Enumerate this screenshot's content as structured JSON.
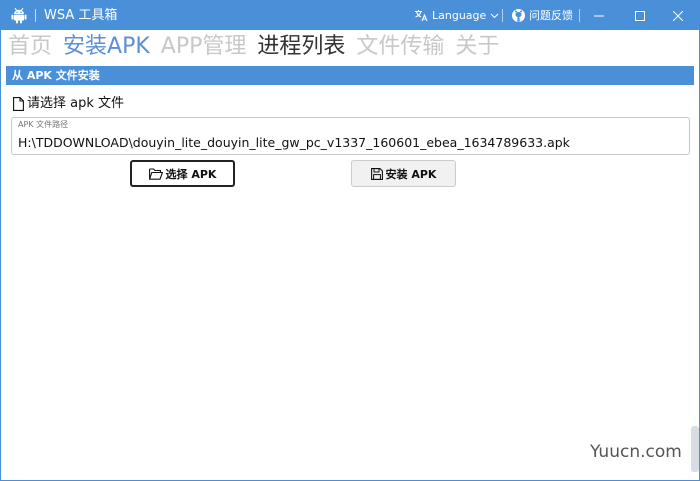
{
  "window": {
    "title": "WSA 工具箱",
    "language_label": "Language",
    "feedback_label": "问题反馈"
  },
  "nav": {
    "tabs": [
      {
        "label": "首页"
      },
      {
        "label": "安装APK"
      },
      {
        "label": "APP管理"
      },
      {
        "label": "进程列表"
      },
      {
        "label": "文件传输"
      },
      {
        "label": "关于"
      }
    ]
  },
  "install": {
    "section_title": "从 APK 文件安装",
    "choose_label": "请选择 apk 文件",
    "path_caption": "APK 文件路径",
    "path_value": "H:\\TDDOWNLOAD\\douyin_lite_douyin_lite_gw_pc_v1337_160601_ebea_1634789633.apk",
    "select_button": "选择 APK",
    "install_button": "安装 APK"
  },
  "watermark": "Yuucn.com",
  "colors": {
    "accent": "#4a90d9",
    "active_tab": "#5b8fd6",
    "inactive_tab": "#c8c8c8"
  }
}
